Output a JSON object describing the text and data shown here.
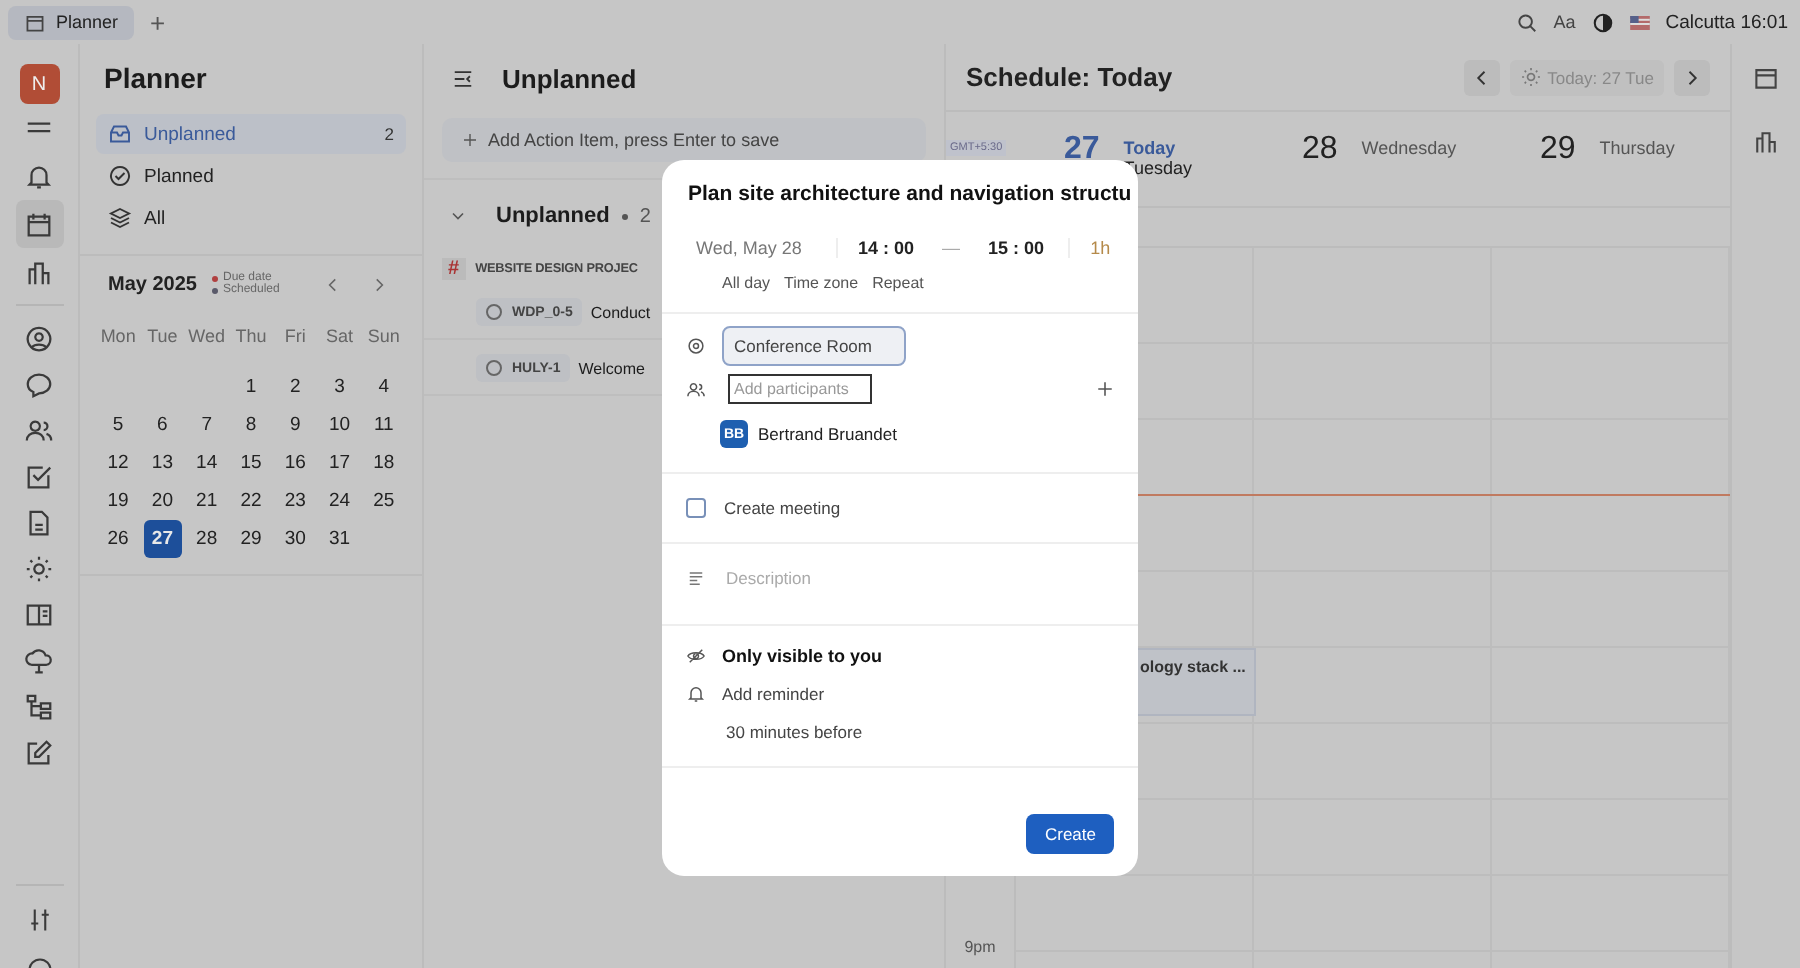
{
  "top_bar": {
    "tabs": [
      {
        "label": "Planner",
        "selected": true
      }
    ],
    "add_tab": "+",
    "font_button": "Aa",
    "city_time": "Calcutta 16:01"
  },
  "nav_rail": {
    "avatar": "N",
    "items": [
      {
        "selected": false
      },
      {
        "selected": false
      },
      {
        "selected": true
      },
      {
        "selected": false
      },
      {
        "selected": false
      },
      {
        "selected": false
      },
      {
        "selected": false
      },
      {
        "selected": false
      },
      {
        "selected": false
      },
      {
        "selected": false
      },
      {
        "selected": false
      },
      {
        "selected": false
      },
      {
        "selected": false
      },
      {
        "selected": false
      }
    ]
  },
  "planner": {
    "title": "Planner",
    "items": [
      {
        "label": "Unplanned",
        "count": "2",
        "selected": true
      },
      {
        "label": "Planned",
        "selected": false
      },
      {
        "label": "All",
        "selected": false
      }
    ],
    "calendar": {
      "month": "May 2025",
      "legend": [
        "Due date",
        "Scheduled"
      ],
      "weekdays": [
        "Mon",
        "Tue",
        "Wed",
        "Thu",
        "Fri",
        "Sat",
        "Sun"
      ],
      "weeks": [
        {
          "days": [
            {
              "label": "1",
              "selected": false
            },
            {
              "label": "2",
              "selected": false
            },
            {
              "label": "3",
              "selected": false
            },
            {
              "label": "4",
              "selected": false
            }
          ]
        },
        {
          "days": [
            {
              "label": "5",
              "selected": false
            },
            {
              "label": "6",
              "selected": false
            },
            {
              "label": "7",
              "selected": false
            },
            {
              "label": "8",
              "selected": false
            },
            {
              "label": "9",
              "selected": false
            },
            {
              "label": "10",
              "selected": false
            },
            {
              "label": "11",
              "selected": false
            }
          ]
        },
        {
          "days": [
            {
              "label": "12",
              "selected": false
            },
            {
              "label": "13",
              "selected": false
            },
            {
              "label": "14",
              "selected": false
            },
            {
              "label": "15",
              "selected": false
            },
            {
              "label": "16",
              "selected": false
            },
            {
              "label": "17",
              "selected": false
            },
            {
              "label": "18",
              "selected": false
            }
          ]
        },
        {
          "days": [
            {
              "label": "19",
              "selected": false
            },
            {
              "label": "20",
              "selected": false
            },
            {
              "label": "21",
              "selected": false
            },
            {
              "label": "22",
              "selected": false
            },
            {
              "label": "23",
              "selected": false
            },
            {
              "label": "24",
              "selected": false
            },
            {
              "label": "25",
              "selected": false
            }
          ]
        },
        {
          "days": [
            {
              "label": "26",
              "selected": false
            },
            {
              "label": "27",
              "selected": true
            },
            {
              "label": "28",
              "selected": false
            },
            {
              "label": "29",
              "selected": false
            },
            {
              "label": "30",
              "selected": false
            },
            {
              "label": "31",
              "selected": false
            }
          ]
        }
      ]
    }
  },
  "unplanned": {
    "title": "Unplanned",
    "add_placeholder": "Add Action Item, press Enter to save",
    "group": {
      "label": "Unplanned",
      "count": "2",
      "expanded": true
    },
    "project": {
      "mark": "#",
      "name": "WEBSITE DESIGN PROJEC"
    },
    "items": [
      {
        "id": "WDP_0-5",
        "title": "Conduct"
      },
      {
        "id": "HULY-1",
        "title": "Welcome"
      }
    ]
  },
  "schedule": {
    "title": "Schedule: Today",
    "today_button": "Today: 27 Tue",
    "timezone": "GMT+5:30",
    "days": [
      {
        "number": "27",
        "today_label": "Today",
        "weekday": "Tuesday",
        "today": true
      },
      {
        "number": "28",
        "weekday": "Wednesday",
        "today": false
      },
      {
        "number": "29",
        "weekday": "Thursday",
        "today": false
      }
    ],
    "event": {
      "title": "ology stack ..."
    },
    "time_label": "9pm"
  },
  "dialog": {
    "title": "Plan site architecture and navigation structu",
    "date": "Wed, May 28",
    "start": "14 : 00",
    "dash": "—",
    "end": "15 : 00",
    "duration": "1h",
    "options": [
      "All day",
      "Time zone",
      "Repeat"
    ],
    "location": "Conference Room",
    "participants_placeholder": "Add participants",
    "participants": [
      {
        "initials": "BB",
        "name": "Bertrand Bruandet"
      }
    ],
    "create_meeting": {
      "label": "Create meeting",
      "checked": false
    },
    "description_placeholder": "Description",
    "visibility": "Only visible to you",
    "reminder": "Add reminder",
    "reminder_value": "30 minutes before",
    "submit": "Create"
  }
}
